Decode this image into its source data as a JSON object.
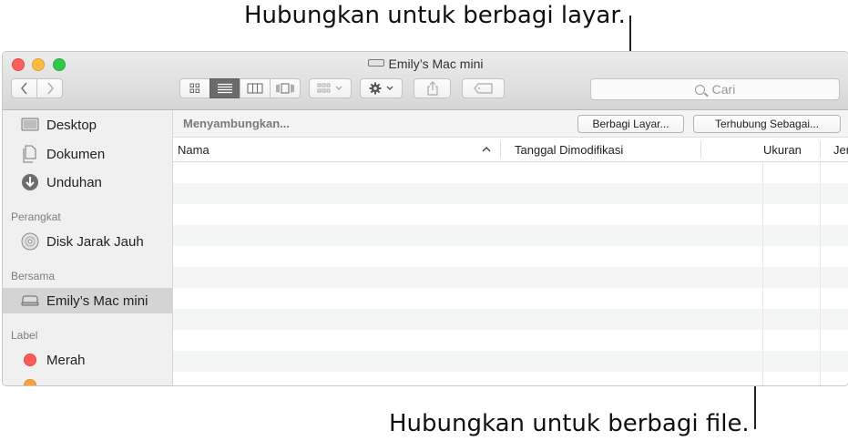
{
  "callouts": {
    "screen_share": "Hubungkan untuk berbagi layar.",
    "file_share": "Hubungkan untuk berbagi file."
  },
  "window": {
    "title": "Emily’s Mac mini"
  },
  "toolbar": {
    "back_icon": "chevron-left-icon",
    "forward_icon": "chevron-right-icon",
    "view_modes": [
      "icon-view-icon",
      "list-view-icon",
      "column-view-icon",
      "cover-flow-icon"
    ],
    "active_view": "list-view-icon",
    "search_placeholder": "Cari"
  },
  "sidebar": {
    "favorites": [
      {
        "label": "Desktop",
        "icon": "desktop-icon"
      },
      {
        "label": "Dokumen",
        "icon": "documents-icon"
      },
      {
        "label": "Unduhan",
        "icon": "downloads-icon"
      }
    ],
    "devices_header": "Perangkat",
    "devices": [
      {
        "label": "Disk Jarak Jauh",
        "icon": "disc-icon"
      }
    ],
    "shared_header": "Bersama",
    "shared": [
      {
        "label": "Emily’s Mac mini",
        "icon": "mac-mini-icon",
        "selected": true
      }
    ],
    "tags_header": "Label",
    "tags": [
      {
        "label": "Merah",
        "color": "#fc5b57"
      },
      {
        "label": "",
        "color": "#f8a33b"
      }
    ]
  },
  "pathbar": {
    "status": "Menyambungkan...",
    "share_screen_label": "Berbagi Layar...",
    "connect_as_label": "Terhubung Sebagai..."
  },
  "columns": {
    "name": "Nama",
    "date_modified": "Tanggal Dimodifikasi",
    "size": "Ukuran",
    "kind": "Jenis"
  }
}
